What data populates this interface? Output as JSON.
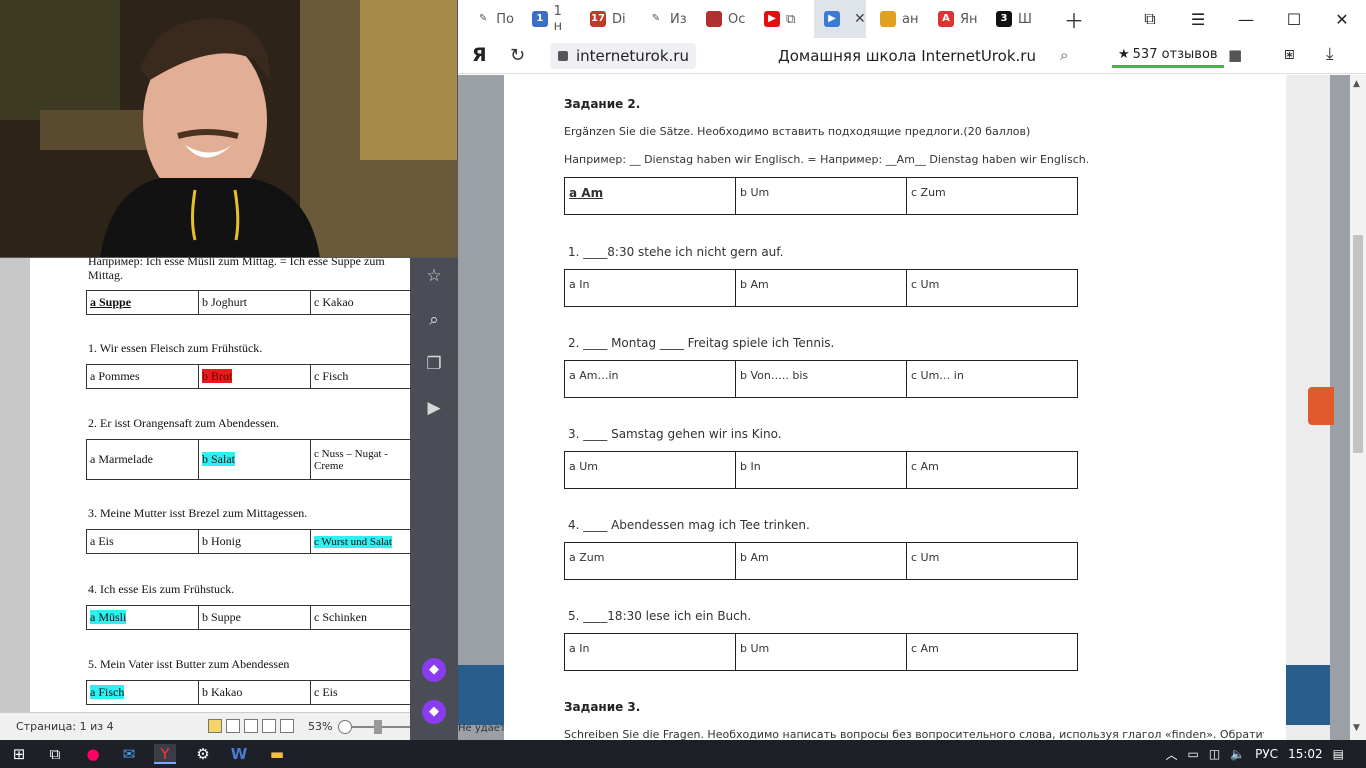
{
  "word": {
    "example_line": "Например: Ich esse Müsli zum Mittag. = Ich esse Suppe zum Mittag.",
    "example_row": [
      "a Suppe",
      "b Joghurt",
      "c Kakao"
    ],
    "sentences": [
      "1. Wir essen Fleisch zum Frühstück.",
      "2. Er isst Orangensaft zum Abendessen.",
      "3. Meine Mutter isst Brezel zum Mittagessen.",
      "4. Ich esse Eis zum Frühstuck.",
      "5. Mein Vater isst Butter zum Abendessen"
    ],
    "rows": [
      [
        "a  Pommes",
        "b Brot",
        "c Fisch"
      ],
      [
        "a Marmelade",
        "b Salat",
        "c Nuss – Nugat - Creme"
      ],
      [
        "a Eis",
        "b Honig",
        "c Wurst und Salat"
      ],
      [
        "a Müsli",
        "b Suppe",
        "c Schinken"
      ],
      [
        "a Fisch",
        "b Kakao",
        "c Eis"
      ]
    ],
    "status": {
      "page": "Страница: 1 из 4",
      "zoom": "53%"
    }
  },
  "browser": {
    "tabs": [
      {
        "label": "По",
        "color": "#555"
      },
      {
        "label": "1 н",
        "color": "#3b6fc7",
        "glyph": "1"
      },
      {
        "label": "Di",
        "color": "#c0392b",
        "glyph": "17"
      },
      {
        "label": "Из",
        "color": "#555"
      },
      {
        "label": "Ос",
        "color": "#b03030"
      },
      {
        "label": "",
        "color": "#e01010"
      },
      {
        "label": "",
        "color": "#3a7bd5"
      },
      {
        "label": "ан",
        "color": "#e0a020"
      },
      {
        "label": "Ян",
        "color": "#d33"
      },
      {
        "label": "Ш",
        "color": "#111",
        "glyph": "3"
      }
    ],
    "address": {
      "logo": "Я",
      "url": "interneturok.ru",
      "title": "Домашняя школа InternetUrok.ru",
      "reviews": "537 отзывов"
    },
    "side_note": "Не удает",
    "bottom_text": "Schreiben Sie die Fragen. Необходимо написать вопросы без вопросительного слова, используя глагол «finden». Обратите"
  },
  "task": {
    "title": "Задание 2.",
    "instruction": "Ergänzen Sie die Sätze. Необходимо вставить подходящие предлоги.(20 баллов)",
    "example": "Например: __ Dienstag haben wir Englisch. = Например: __Am__ Dienstag haben wir Englisch.",
    "example_row": [
      "a Am",
      "b Um",
      "c Zum"
    ],
    "questions": [
      {
        "text": "1. ____8:30 stehe ich nicht gern auf.",
        "options": [
          "a In",
          "b Am",
          "c Um"
        ]
      },
      {
        "text": "2. ____ Montag ____ Freitag spiele ich Tennis.",
        "options": [
          "a Am…in",
          "b Von….. bis",
          "c Um… in"
        ]
      },
      {
        "text": "3. ____ Samstag gehen wir ins Kino.",
        "options": [
          "a Um",
          "b In",
          "c Am"
        ]
      },
      {
        "text": "4. ____ Abendessen mag ich Tee trinken.",
        "options": [
          "a Zum",
          "b Am",
          "c Um"
        ]
      },
      {
        "text": "5. ____18:30 lese ich ein Buch.",
        "options": [
          "a In",
          "b Um",
          "c Am"
        ]
      }
    ],
    "next_title": "Задание 3."
  },
  "taskbar": {
    "lang": "РУС",
    "time": "15:02"
  },
  "colors": {
    "highlight": "#2ff0f0",
    "red_highlight": "#e51c1c",
    "alice": "#8a3cf0",
    "bluebar": "#285d8c"
  }
}
